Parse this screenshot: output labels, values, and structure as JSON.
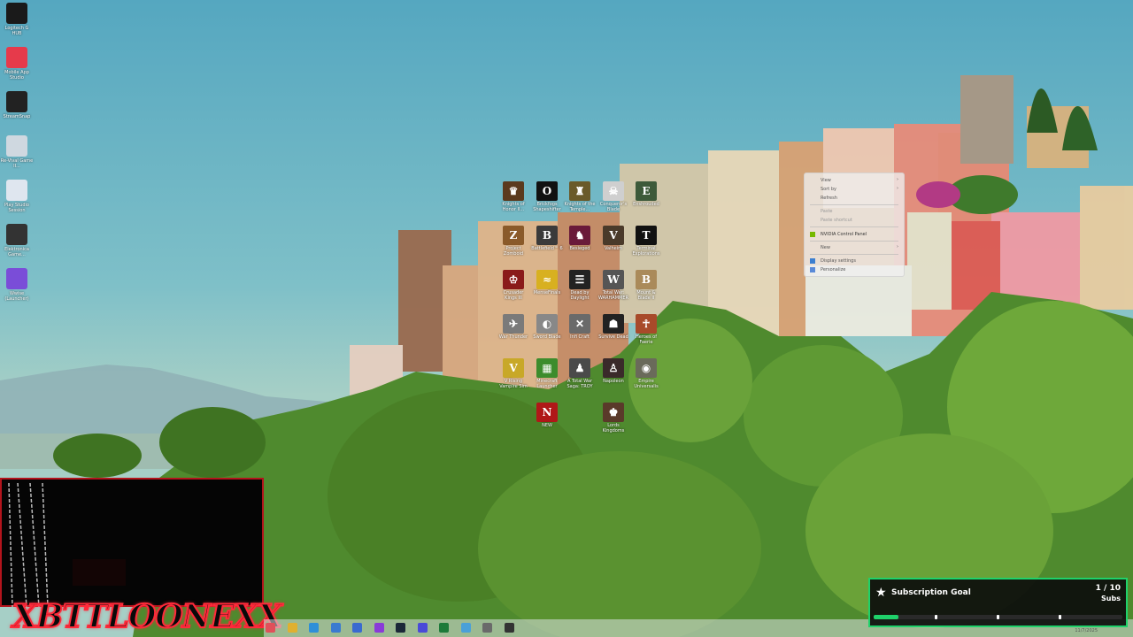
{
  "desktop_left_icons": [
    {
      "label": "Logitech G HUB",
      "icon": "logitech-g-icon",
      "color": "#1a1a1a"
    },
    {
      "label": "Mobile App Studio",
      "icon": "app-studio-icon",
      "color": "#e63a4b"
    },
    {
      "label": "StreamSnap",
      "icon": "stream-icon",
      "color": "#222"
    },
    {
      "label": "Re-Vival Game II...",
      "icon": "game-file-icon",
      "color": "#cfd8e0"
    },
    {
      "label": "Play Studio Session",
      "icon": "session-icon",
      "color": "#dfe6ef"
    },
    {
      "label": "Elektronica Game...",
      "icon": "elektronica-icon",
      "color": "#333"
    },
    {
      "label": "Wwise (Launcher)",
      "icon": "wwise-icon",
      "color": "#7a4dd8"
    }
  ],
  "desktop_grid_icons": [
    {
      "label": "Knights of Honor II...",
      "color": "#5b3a1e",
      "glyph": "♛"
    },
    {
      "label": "Brickfogs Shapeshifter",
      "color": "#111",
      "glyph": "O"
    },
    {
      "label": "Knights of the Temple...",
      "color": "#6a5a2a",
      "glyph": "♜"
    },
    {
      "label": "Conqueror's Blade",
      "color": "#cfcfcf",
      "glyph": "☠"
    },
    {
      "label": "Enshrouded",
      "color": "#3d5a3a",
      "glyph": "E"
    },
    {
      "label": "Project Zomboid",
      "color": "#8a5a2a",
      "glyph": "Z"
    },
    {
      "label": "Battlefield™ 6",
      "color": "#3a3a3a",
      "glyph": "B"
    },
    {
      "label": "Besieged",
      "color": "#6a1a3a",
      "glyph": "♞"
    },
    {
      "label": "Valheim",
      "color": "#4a3a2a",
      "glyph": "V"
    },
    {
      "label": "Terminal Explorations",
      "color": "#111",
      "glyph": "T"
    },
    {
      "label": "Crusader Kings III",
      "color": "#8a1a1a",
      "glyph": "♔"
    },
    {
      "label": "MenseFinals",
      "color": "#d8b020",
      "glyph": "≈"
    },
    {
      "label": "Dead by Daylight",
      "color": "#222",
      "glyph": "☰"
    },
    {
      "label": "Total War: WARHAMMER",
      "color": "#555",
      "glyph": "W"
    },
    {
      "label": "Mount & Blade II",
      "color": "#aa8a5a",
      "glyph": "B"
    },
    {
      "label": "War Thunder",
      "color": "#7a7a7a",
      "glyph": "✈"
    },
    {
      "label": "Sword Blade",
      "color": "#888",
      "glyph": "◐"
    },
    {
      "label": "Infi Craft",
      "color": "#6a6a6a",
      "glyph": "✕"
    },
    {
      "label": "Survive Dead",
      "color": "#222",
      "glyph": "☗"
    },
    {
      "label": "Heroes of Faerie",
      "color": "#a84a2a",
      "glyph": "☥"
    },
    {
      "label": "V Rising Vampire Sim",
      "color": "#c8a828",
      "glyph": "V"
    },
    {
      "label": "Minecraft Launcher",
      "color": "#3c8c2c",
      "glyph": "▦"
    },
    {
      "label": "A Total War Saga: TROY",
      "color": "#4a4a4a",
      "glyph": "♟"
    },
    {
      "label": "Napoleon",
      "color": "#3a2a2a",
      "glyph": "♙"
    },
    {
      "label": "Empire Universalis",
      "color": "#6a6a5a",
      "glyph": "◉"
    },
    {
      "label": "NEW",
      "color": "#b01818",
      "glyph": "N"
    },
    {
      "label": "Lords Kingdoms",
      "color": "#5a3a2a",
      "glyph": "♚"
    }
  ],
  "context_menu": {
    "view": "View",
    "sort_by": "Sort by",
    "refresh": "Refresh",
    "paste": "Paste",
    "paste_shortcut": "Paste shortcut",
    "nvidia": "NVIDIA Control Panel",
    "new": "New",
    "display_settings": "Display settings",
    "personalize": "Personalize"
  },
  "webcam": {
    "logo": "XBTTLOONEXX"
  },
  "taskbar": {
    "icons": [
      {
        "name": "start-icon",
        "color": "#e0505a"
      },
      {
        "name": "explorer-icon",
        "color": "#e0b030"
      },
      {
        "name": "edge-icon",
        "color": "#2f8fd8"
      },
      {
        "name": "bluetooth-icon",
        "color": "#3a7ad0"
      },
      {
        "name": "store-icon",
        "color": "#3a6ad0"
      },
      {
        "name": "twitch-icon",
        "color": "#8a3ad8"
      },
      {
        "name": "steam-icon",
        "color": "#1b2838"
      },
      {
        "name": "epic-icon",
        "color": "#4a4ad8"
      },
      {
        "name": "excel-icon",
        "color": "#1d7a3a"
      },
      {
        "name": "notepad-icon",
        "color": "#4aa0d8"
      },
      {
        "name": "settings-icon",
        "color": "#6a6a6a"
      },
      {
        "name": "obs-icon",
        "color": "#333"
      }
    ],
    "clock": "11/7/2025"
  },
  "subscription_goal": {
    "title": "Subscription Goal",
    "count": "1 / 10",
    "unit": "Subs",
    "progress": 0.1,
    "accent": "#1fd16a"
  }
}
